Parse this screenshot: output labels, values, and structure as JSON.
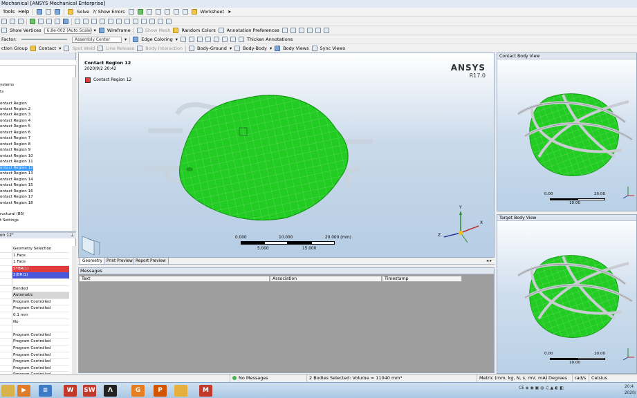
{
  "window": {
    "title": "Mechanical [ANSYS Mechanical Enterprise]"
  },
  "menu": {
    "items": [
      "Tools",
      "Help"
    ]
  },
  "toolbar1": {
    "solve": "Solve",
    "show_errors": "?/ Show Errors",
    "worksheet": "Worksheet"
  },
  "toolbar2": {
    "show_vertices": "Show Vertices",
    "scale": "6.8e-002 (Auto Scale)",
    "wireframe": "Wireframe",
    "show_mesh": "Show Mesh",
    "random_colors": "Random Colors",
    "annotation_prefs": "Annotation Preferences"
  },
  "toolbar3": {
    "factor_label": "Factor:",
    "assembly_center": "Assembly Center",
    "edge_coloring": "Edge Coloring",
    "thicken_annotations": "Thicken Annotations"
  },
  "toolbar4": {
    "connection_group": "ction Group",
    "contact": "Contact",
    "spot_weld": "Spot Weld",
    "line_release": "Line Release",
    "body_interaction": "Body Interaction",
    "body_ground": "Body-Ground",
    "body_body": "Body-Body",
    "body_views": "Body Views",
    "sync_views": "Sync Views"
  },
  "tree": {
    "items": [
      "ystems",
      "ts",
      "ontact Region",
      "ontact Region 2",
      "ontact Region 3",
      "ontact Region 4",
      "ontact Region 5",
      "ontact Region 6",
      "ontact Region 7",
      "ontact Region 8",
      "ontact Region 9",
      "ontact Region 10",
      "ontact Region 11",
      "ontact Region 12",
      "ontact Region 13",
      "ontact Region 14",
      "ontact Region 15",
      "ontact Region 16",
      "ontact Region 17",
      "ontact Region 18",
      "ructural (B5)",
      "t Settings"
    ],
    "selected": "ontact Region 12"
  },
  "details": {
    "title": "on 12\"",
    "rows": [
      {
        "value": "Geometry Selection",
        "style": ""
      },
      {
        "value": "1 Face",
        "style": ""
      },
      {
        "value": "1 Face",
        "style": ""
      },
      {
        "value": "SYBR(1)",
        "style": "red"
      },
      {
        "value": "3(BR(1)",
        "style": "blue"
      },
      {
        "value": "",
        "style": ""
      },
      {
        "value": "Bonded",
        "style": ""
      },
      {
        "value": "Automatic",
        "style": "gray"
      },
      {
        "value": "Program Controlled",
        "style": ""
      },
      {
        "value": "Program Controlled",
        "style": ""
      },
      {
        "value": "0.1 mm",
        "style": ""
      },
      {
        "value": "No",
        "style": ""
      },
      {
        "value": "",
        "style": ""
      },
      {
        "value": "Program Controlled",
        "style": ""
      },
      {
        "value": "Program Controlled",
        "style": ""
      },
      {
        "value": "Program Controlled",
        "style": ""
      },
      {
        "value": "Program Controlled",
        "style": ""
      },
      {
        "value": "Program Controlled",
        "style": ""
      },
      {
        "value": "Program Controlled",
        "style": ""
      },
      {
        "value": "Program Controlled",
        "style": ""
      }
    ]
  },
  "viewport": {
    "title": "Contact Region 12",
    "date": "2020/9/2 20:42",
    "legend_item": "Contact Region 12",
    "legend_color": "#e43b3b",
    "brand": "ANSYS",
    "version": "R17.0",
    "scale_top": [
      "0.000",
      "10.000",
      "20.000 (mm)"
    ],
    "scale_bottom": [
      "5.000",
      "15.000"
    ],
    "axis": [
      "X",
      "Y",
      "Z"
    ]
  },
  "tabs": [
    "Geometry",
    "Print Preview",
    "Report Preview"
  ],
  "messages": {
    "title": "Messages",
    "columns": [
      "Text",
      "Association",
      "Timestamp"
    ]
  },
  "contact_view": {
    "title": "Contact Body View",
    "scale_top": [
      "0.00",
      "20.00"
    ],
    "scale_bottom": "10.00"
  },
  "target_view": {
    "title": "Target Body View",
    "scale_top": [
      "0.00",
      "20.00"
    ],
    "scale_bottom": "10.00"
  },
  "status": {
    "messages": "No Messages",
    "selection": "2 Bodies Selected: Volume = 11040 mm³",
    "units": "Metric (mm, kg, N, s, mV, mA)",
    "degrees": "Degrees",
    "rads": "rad/s",
    "celsius": "Celsius"
  },
  "taskbar": {
    "apps": [
      {
        "icon": "explorer-icon",
        "color": "#d9b24a",
        "letter": ""
      },
      {
        "icon": "media-icon",
        "color": "#e07b2a",
        "letter": "▶"
      },
      {
        "icon": "app-icon",
        "color": "#3e7bc4",
        "letter": "≡"
      },
      {
        "icon": "word-icon",
        "color": "#c0392b",
        "letter": "W"
      },
      {
        "icon": "solidworks-icon",
        "color": "#c0392b",
        "letter": "SW"
      },
      {
        "icon": "ansys-icon",
        "color": "#222222",
        "letter": "Λ"
      },
      {
        "icon": "chrome-icon",
        "color": "#e67e22",
        "letter": "G"
      },
      {
        "icon": "powerpoint-icon",
        "color": "#d35400",
        "letter": "P"
      },
      {
        "icon": "folder-icon",
        "color": "#e6b040",
        "letter": ""
      },
      {
        "icon": "mcafee-icon",
        "color": "#c0392b",
        "letter": "M"
      }
    ],
    "clock_time": "20:4",
    "clock_date": "2020/"
  },
  "colors": {
    "body": "#22cc22",
    "selection": "#3399ff"
  }
}
